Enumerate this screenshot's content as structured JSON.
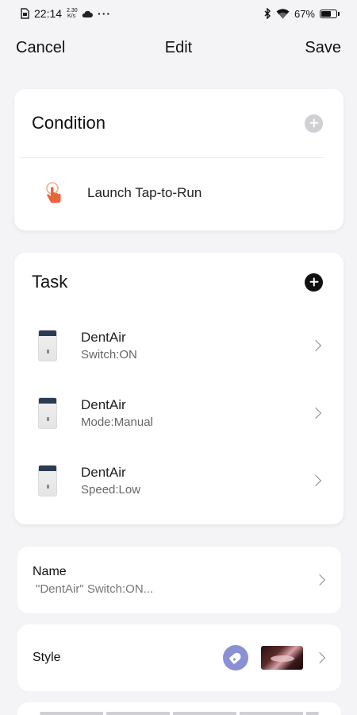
{
  "status_bar": {
    "time": "22:14",
    "speed_value": "2.30",
    "speed_unit": "K/s",
    "more": "···",
    "battery": "67%",
    "battery_level": 0.67
  },
  "nav": {
    "cancel": "Cancel",
    "title": "Edit",
    "save": "Save"
  },
  "condition": {
    "title": "Condition",
    "item_label": "Launch Tap-to-Run",
    "add_color": "#cfcfd4",
    "icon_color": "#e8663a"
  },
  "task": {
    "title": "Task",
    "add_color": "#111111",
    "items": [
      {
        "name": "DentAir",
        "detail": "Switch:ON"
      },
      {
        "name": "DentAir",
        "detail": "Mode:Manual"
      },
      {
        "name": "DentAir",
        "detail": "Speed:Low"
      }
    ]
  },
  "name_section": {
    "label": "Name",
    "value": "\"DentAir\" Switch:ON..."
  },
  "style_section": {
    "label": "Style",
    "tag_color": "#8a8fd6"
  }
}
